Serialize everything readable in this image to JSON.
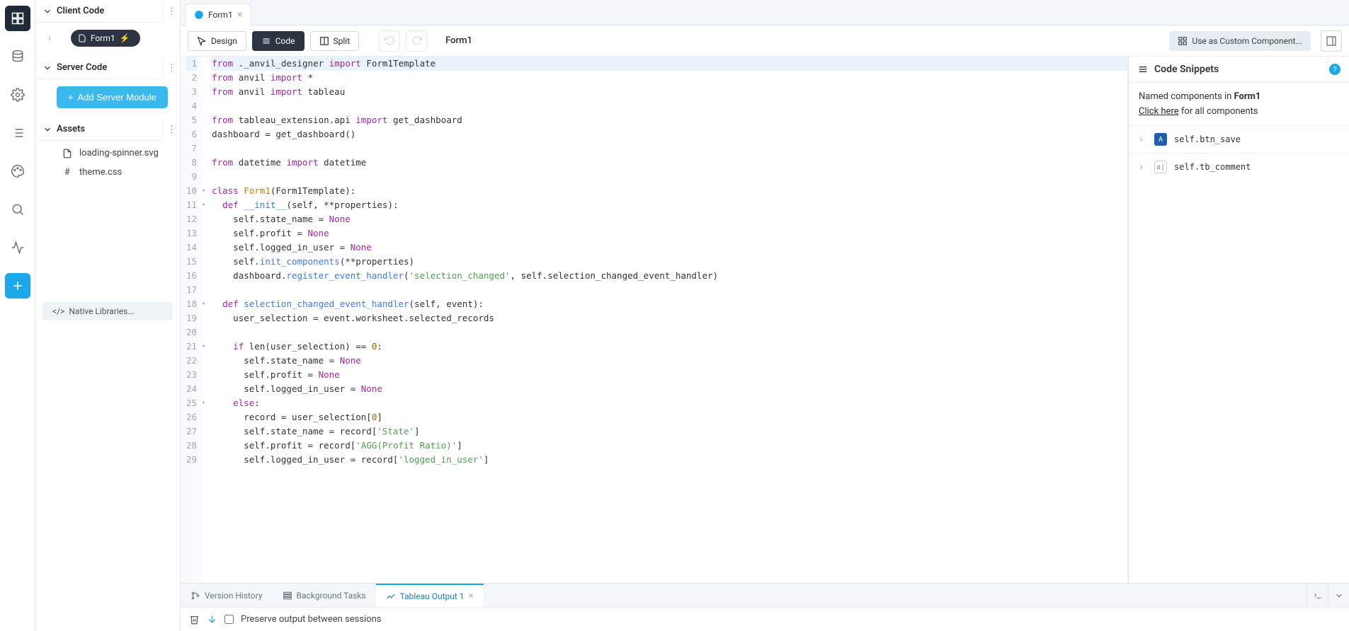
{
  "sidebar": {
    "sections": {
      "client": {
        "title": "Client Code",
        "form": "Form1"
      },
      "server": {
        "title": "Server Code",
        "add_btn": "Add Server Module"
      },
      "assets": {
        "title": "Assets",
        "items": [
          "loading-spinner.svg",
          "theme.css"
        ]
      }
    },
    "native_libs": "Native Libraries..."
  },
  "tabs": {
    "file_tab": "Form1"
  },
  "toolbar": {
    "design": "Design",
    "code": "Code",
    "split": "Split",
    "breadcrumb": "Form1",
    "custom_component": "Use as Custom Component..."
  },
  "code": {
    "lines": [
      {
        "n": 1,
        "hl": true,
        "tokens": [
          [
            "kw",
            "from"
          ],
          [
            "",
            " ._anvil_designer "
          ],
          [
            "imp",
            "import"
          ],
          [
            "",
            " Form1Template"
          ]
        ]
      },
      {
        "n": 2,
        "tokens": [
          [
            "kw",
            "from"
          ],
          [
            "",
            " anvil "
          ],
          [
            "imp",
            "import"
          ],
          [
            "",
            " *"
          ]
        ]
      },
      {
        "n": 3,
        "tokens": [
          [
            "kw",
            "from"
          ],
          [
            "",
            " anvil "
          ],
          [
            "imp",
            "import"
          ],
          [
            "",
            " tableau"
          ]
        ]
      },
      {
        "n": 4,
        "tokens": []
      },
      {
        "n": 5,
        "tokens": [
          [
            "kw",
            "from"
          ],
          [
            "",
            " tableau_extension.api "
          ],
          [
            "imp",
            "import"
          ],
          [
            "",
            " get_dashboard"
          ]
        ]
      },
      {
        "n": 6,
        "tokens": [
          [
            "",
            "dashboard = get_dashboard()"
          ]
        ]
      },
      {
        "n": 7,
        "tokens": []
      },
      {
        "n": 8,
        "tokens": [
          [
            "kw",
            "from"
          ],
          [
            "",
            " datetime "
          ],
          [
            "imp",
            "import"
          ],
          [
            "",
            " datetime"
          ]
        ]
      },
      {
        "n": 9,
        "tokens": []
      },
      {
        "n": 10,
        "fold": true,
        "tokens": [
          [
            "kw",
            "class"
          ],
          [
            "",
            " "
          ],
          [
            "cls",
            "Form1"
          ],
          [
            "",
            "(Form1Template):"
          ]
        ]
      },
      {
        "n": 11,
        "fold": true,
        "tokens": [
          [
            "",
            "  "
          ],
          [
            "kw",
            "def"
          ],
          [
            "",
            " "
          ],
          [
            "fn",
            "__init__"
          ],
          [
            "",
            "(self, **properties):"
          ]
        ]
      },
      {
        "n": 12,
        "tokens": [
          [
            "",
            "    self.state_name = "
          ],
          [
            "none",
            "None"
          ]
        ]
      },
      {
        "n": 13,
        "tokens": [
          [
            "",
            "    self.profit = "
          ],
          [
            "none",
            "None"
          ]
        ]
      },
      {
        "n": 14,
        "tokens": [
          [
            "",
            "    self.logged_in_user = "
          ],
          [
            "none",
            "None"
          ]
        ]
      },
      {
        "n": 15,
        "tokens": [
          [
            "",
            "    self."
          ],
          [
            "fn",
            "init_components"
          ],
          [
            "",
            "(**properties)"
          ]
        ]
      },
      {
        "n": 16,
        "tokens": [
          [
            "",
            "    dashboard."
          ],
          [
            "fn",
            "register_event_handler"
          ],
          [
            "",
            "("
          ],
          [
            "str",
            "'selection_changed'"
          ],
          [
            "",
            ", self.selection_changed_event_handler)"
          ]
        ]
      },
      {
        "n": 17,
        "tokens": []
      },
      {
        "n": 18,
        "fold": true,
        "tokens": [
          [
            "",
            "  "
          ],
          [
            "kw",
            "def"
          ],
          [
            "",
            " "
          ],
          [
            "fn",
            "selection_changed_event_handler"
          ],
          [
            "",
            "(self, event):"
          ]
        ]
      },
      {
        "n": 19,
        "tokens": [
          [
            "",
            "    user_selection = event.worksheet.selected_records"
          ]
        ]
      },
      {
        "n": 20,
        "tokens": []
      },
      {
        "n": 21,
        "fold": true,
        "tokens": [
          [
            "",
            "    "
          ],
          [
            "kw",
            "if"
          ],
          [
            "",
            " len(user_selection) == "
          ],
          [
            "num",
            "0"
          ],
          [
            "",
            ":"
          ]
        ]
      },
      {
        "n": 22,
        "tokens": [
          [
            "",
            "      self.state_name = "
          ],
          [
            "none",
            "None"
          ]
        ]
      },
      {
        "n": 23,
        "tokens": [
          [
            "",
            "      self.profit = "
          ],
          [
            "none",
            "None"
          ]
        ]
      },
      {
        "n": 24,
        "tokens": [
          [
            "",
            "      self.logged_in_user = "
          ],
          [
            "none",
            "None"
          ]
        ]
      },
      {
        "n": 25,
        "fold": true,
        "tokens": [
          [
            "",
            "    "
          ],
          [
            "kw",
            "else"
          ],
          [
            "",
            ":"
          ]
        ]
      },
      {
        "n": 26,
        "tokens": [
          [
            "",
            "      record = user_selection["
          ],
          [
            "num",
            "0"
          ],
          [
            "",
            "]"
          ]
        ]
      },
      {
        "n": 27,
        "tokens": [
          [
            "",
            "      self.state_name = record["
          ],
          [
            "str",
            "'State'"
          ],
          [
            "",
            "]"
          ]
        ]
      },
      {
        "n": 28,
        "tokens": [
          [
            "",
            "      self.profit = record["
          ],
          [
            "str",
            "'AGG(Profit Ratio)'"
          ],
          [
            "",
            "]"
          ]
        ]
      },
      {
        "n": 29,
        "tokens": [
          [
            "",
            "      self.logged_in_user = record["
          ],
          [
            "str",
            "'logged_in_user'"
          ],
          [
            "",
            "]"
          ]
        ]
      }
    ]
  },
  "snippets": {
    "title": "Code Snippets",
    "named_in_prefix": "Named components in ",
    "named_in_form": "Form1",
    "click_here": "Click here",
    "for_all": " for all components",
    "components": [
      {
        "icon": "A",
        "style": "blue",
        "name": "self.btn_save"
      },
      {
        "icon": "a|",
        "style": "outline",
        "name": "self.tb_comment"
      }
    ]
  },
  "bottom": {
    "tabs": [
      "Version History",
      "Background Tasks",
      "Tableau Output 1"
    ],
    "active": 2,
    "preserve": "Preserve output between sessions"
  }
}
